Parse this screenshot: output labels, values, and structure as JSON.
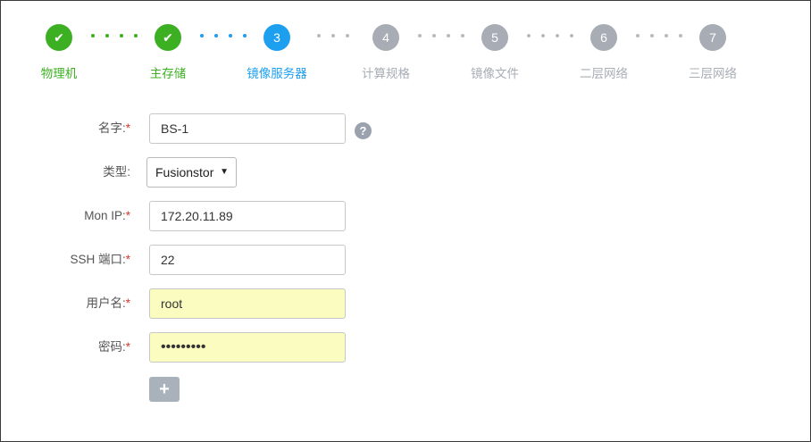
{
  "stepper": {
    "steps": [
      {
        "number": "1",
        "label": "物理机",
        "state": "done"
      },
      {
        "number": "2",
        "label": "主存储",
        "state": "done"
      },
      {
        "number": "3",
        "label": "镜像服务器",
        "state": "active"
      },
      {
        "number": "4",
        "label": "计算规格",
        "state": "todo"
      },
      {
        "number": "5",
        "label": "镜像文件",
        "state": "todo"
      },
      {
        "number": "6",
        "label": "二层网络",
        "state": "todo"
      },
      {
        "number": "7",
        "label": "三层网络",
        "state": "todo"
      }
    ],
    "check_glyph": "✔",
    "colors": {
      "done": "#3cb022",
      "active": "#1d9ff0",
      "todo": "#a8adb5"
    }
  },
  "form": {
    "required_mark": "*",
    "name": {
      "label": "名字:",
      "value": "BS-1"
    },
    "type": {
      "label": "类型:",
      "value": "Fusionstor",
      "caret": "▼"
    },
    "mon_ip": {
      "label": "Mon IP:",
      "value": "172.20.11.89"
    },
    "ssh_port": {
      "label": "SSH 端口:",
      "value": "22"
    },
    "username": {
      "label": "用户名:",
      "value": "root"
    },
    "password": {
      "label": "密码:",
      "value": "•••••••••"
    },
    "help_icon": "?",
    "add_icon": "+"
  }
}
